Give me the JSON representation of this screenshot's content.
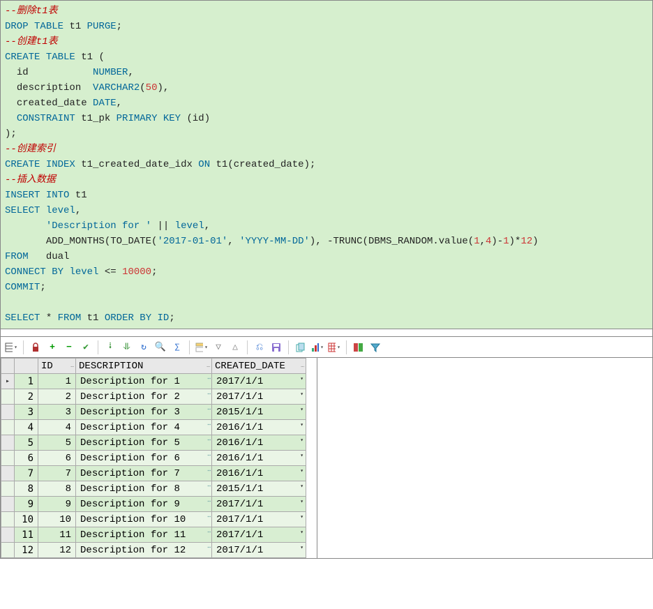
{
  "editor": {
    "comment_drop": "--删除t1表",
    "drop_kw1": "DROP",
    "drop_kw2": "TABLE",
    "drop_tbl": "t1",
    "drop_kw3": "PURGE",
    "comment_create": "--创建t1表",
    "create_kw1": "CREATE",
    "create_kw2": "TABLE",
    "create_tbl": "t1",
    "col_id": "id",
    "col_id_type": "NUMBER",
    "col_desc": "description",
    "col_desc_type": "VARCHAR2",
    "col_desc_len": "50",
    "col_date": "created_date",
    "col_date_type": "DATE",
    "constraint_kw": "CONSTRAINT",
    "pk_name": "t1_pk",
    "pk_kw1": "PRIMARY",
    "pk_kw2": "KEY",
    "pk_col": "id",
    "comment_index": "--创建索引",
    "idx_kw1": "CREATE",
    "idx_kw2": "INDEX",
    "idx_name": "t1_created_date_idx",
    "idx_on": "ON",
    "idx_tbl": "t1",
    "idx_col": "created_date",
    "comment_insert": "--插入数据",
    "ins_kw1": "INSERT",
    "ins_kw2": "INTO",
    "ins_tbl": "t1",
    "sel_kw": "SELECT",
    "level_kw": "level",
    "desc_lit": "'Description for '",
    "concat": "||",
    "addm": "ADD_MONTHS",
    "todate": "TO_DATE",
    "date_lit": "'2017-01-01'",
    "fmt_lit": "'YYYY-MM-DD'",
    "trunc": "TRUNC",
    "dbms": "DBMS_RANDOM.value",
    "rand_a": "1",
    "rand_b": "4",
    "minus1": "1",
    "times12": "12",
    "from_kw": "FROM",
    "dual": "dual",
    "connect_kw": "CONNECT",
    "by_kw": "BY",
    "lte": "<=",
    "limit": "10000",
    "commit": "COMMIT",
    "sel2_kw": "SELECT",
    "star": "*",
    "from2": "FROM",
    "tbl2": "t1",
    "order_kw": "ORDER",
    "by2_kw": "BY",
    "order_col": "ID"
  },
  "headers": {
    "id": "ID",
    "desc": "DESCRIPTION",
    "date": "CREATED_DATE"
  },
  "rows": [
    {
      "n": "1",
      "id": "1",
      "desc": "Description for 1",
      "date": "2017/1/1",
      "ind": "▸"
    },
    {
      "n": "2",
      "id": "2",
      "desc": "Description for 2",
      "date": "2017/1/1",
      "ind": ""
    },
    {
      "n": "3",
      "id": "3",
      "desc": "Description for 3",
      "date": "2015/1/1",
      "ind": ""
    },
    {
      "n": "4",
      "id": "4",
      "desc": "Description for 4",
      "date": "2016/1/1",
      "ind": ""
    },
    {
      "n": "5",
      "id": "5",
      "desc": "Description for 5",
      "date": "2016/1/1",
      "ind": ""
    },
    {
      "n": "6",
      "id": "6",
      "desc": "Description for 6",
      "date": "2016/1/1",
      "ind": ""
    },
    {
      "n": "7",
      "id": "7",
      "desc": "Description for 7",
      "date": "2016/1/1",
      "ind": ""
    },
    {
      "n": "8",
      "id": "8",
      "desc": "Description for 8",
      "date": "2015/1/1",
      "ind": ""
    },
    {
      "n": "9",
      "id": "9",
      "desc": "Description for 9",
      "date": "2017/1/1",
      "ind": ""
    },
    {
      "n": "10",
      "id": "10",
      "desc": "Description for 10",
      "date": "2017/1/1",
      "ind": ""
    },
    {
      "n": "11",
      "id": "11",
      "desc": "Description for 11",
      "date": "2017/1/1",
      "ind": ""
    },
    {
      "n": "12",
      "id": "12",
      "desc": "Description for 12",
      "date": "2017/1/1",
      "ind": ""
    }
  ],
  "colors": {
    "keyword": "#006699",
    "comment": "#c00000",
    "number": "#cc3333",
    "editor_bg": "#d6efce",
    "row_bg": "#d8eed2",
    "row_bg_alt": "#eaf5e6"
  }
}
